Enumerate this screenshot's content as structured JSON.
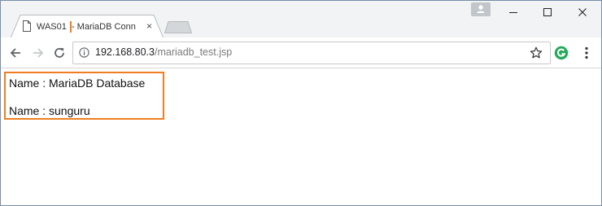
{
  "browser": {
    "tab": {
      "title_highlight": "WAS01",
      "title_rest": " - MariaDB Conn",
      "close_glyph": "×"
    },
    "address_bar": {
      "host": "192.168.80.3",
      "path": "/mariadb_test.jsp"
    },
    "window_controls": {
      "minimize": "–",
      "maximize": "☐",
      "close": "✕"
    }
  },
  "page": {
    "lines": [
      "Name : MariaDB Database",
      "Name : sunguru"
    ]
  },
  "colors": {
    "highlight": "#ef7d22",
    "extension": "#25a85a"
  }
}
